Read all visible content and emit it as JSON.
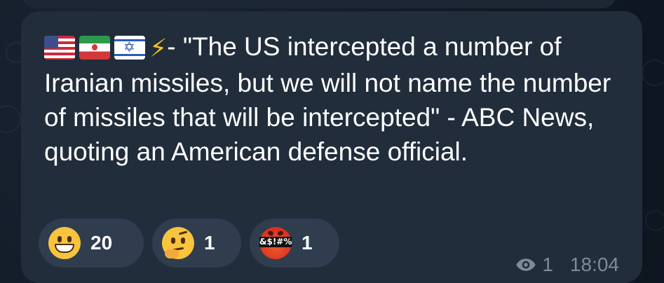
{
  "message": {
    "flags": [
      "us-flag",
      "iran-flag",
      "israel-flag",
      "lightning-icon"
    ],
    "text": "- \"The US intercepted a number of Iranian missiles, but we will not name the number of missiles that will be intercepted\" - ABC News, quoting an American defense official."
  },
  "reactions": [
    {
      "icon": "grinning-face",
      "count": "20"
    },
    {
      "icon": "thinking-face",
      "count": "1"
    },
    {
      "icon": "cursing-face",
      "count": "1",
      "symbols": "&$!#%"
    }
  ],
  "meta": {
    "views": "1",
    "time": "18:04"
  },
  "colors": {
    "background": "#0e1621",
    "bubble": "#212d3b",
    "reaction_pill": "#2f3d4f",
    "meta_text": "#7d8b99"
  }
}
